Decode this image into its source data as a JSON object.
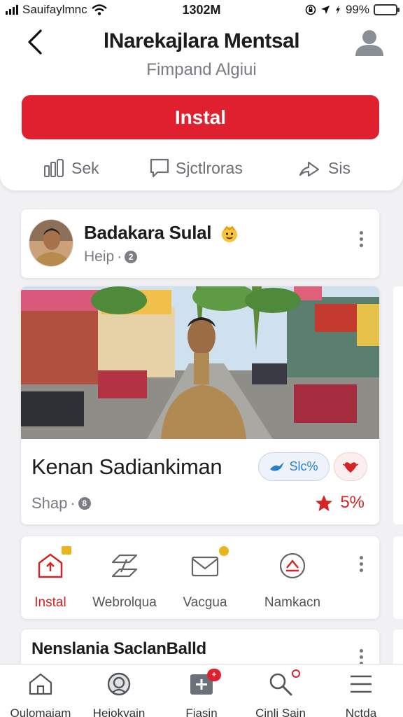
{
  "status_bar": {
    "carrier": "Sauifaylmnc",
    "time": "1302M",
    "battery": "99%",
    "battery_level": 0.99
  },
  "header": {
    "title": "lNarekajlara Mentsal",
    "subtitle": "Fimpand Algiui",
    "install_label": "Instal",
    "actions": [
      {
        "label": "Sek",
        "icon": "thumbs-up-icon"
      },
      {
        "label": "Sjctlroras",
        "icon": "chat-bubble-icon"
      },
      {
        "label": "Sis",
        "icon": "share-icon"
      }
    ]
  },
  "developer": {
    "name": "Badakara Sulal",
    "meta": "Heip",
    "meta_count": "2"
  },
  "featured": {
    "title": "Kenan Sadiankiman",
    "chip_label": "Slc%",
    "meta": "Shap",
    "meta_count": "8",
    "rating": "5%"
  },
  "quick_actions": [
    {
      "label": "Instal",
      "icon": "upload-box-icon"
    },
    {
      "label": "Webrolqua",
      "icon": "transfer-icon"
    },
    {
      "label": "Vacgua",
      "icon": "mail-icon"
    },
    {
      "label": "Namkacn",
      "icon": "badge-icon"
    }
  ],
  "list": {
    "title": "Nenslania SaclanBalld"
  },
  "bottom_nav": [
    {
      "label": "Oulomajam",
      "icon": "home-icon"
    },
    {
      "label": "Heiokyain",
      "icon": "target-icon"
    },
    {
      "label": "Fiasin",
      "icon": "plus-box-icon",
      "badge": "+"
    },
    {
      "label": "Cinli Sain",
      "icon": "search-icon"
    },
    {
      "label": "Nctda",
      "icon": "menu-icon"
    }
  ],
  "colors": {
    "accent": "#e0202e",
    "chip_blue": "#2780c9",
    "rating_red": "#d62222"
  }
}
